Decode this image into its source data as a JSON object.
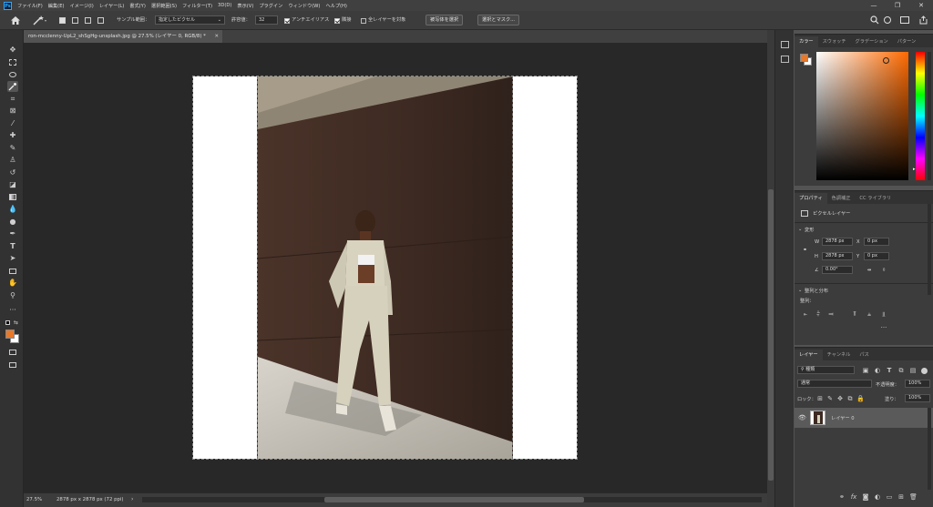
{
  "app": {
    "logo": "Ps"
  },
  "menu": [
    "ファイル(F)",
    "編集(E)",
    "イメージ(I)",
    "レイヤー(L)",
    "書式(Y)",
    "選択範囲(S)",
    "フィルター(T)",
    "3D(D)",
    "表示(V)",
    "プラグイン",
    "ウィンドウ(W)",
    "ヘルプ(H)"
  ],
  "window_controls": {
    "minimize": "—",
    "restore": "❐",
    "close": "✕"
  },
  "options": {
    "sample_label": "サンプル範囲：",
    "sample_value": "指定したピクセル",
    "tolerance_label": "許容値：",
    "tolerance_value": "32",
    "antialias_label": "アンチエイリアス",
    "contiguous_label": "隣接",
    "all_layers_label": "全レイヤーを対象",
    "select_subject_button": "被写体を選択",
    "select_mask_button": "選択とマスク..."
  },
  "document": {
    "tab_title": "ron-mcclenny-UpL2_shSgHg-unsplash.jpg @ 27.5% (レイヤー 0, RGB/8) *",
    "zoom": "27.5%",
    "size_info": "2878 px x 2878 px (72 ppi)"
  },
  "color_panel": {
    "tabs": [
      "カラー",
      "スウォッチ",
      "グラデーション",
      "パターン"
    ],
    "foreground": "#e8792a",
    "background": "#ffffff",
    "hue": "#ff6a00"
  },
  "properties_panel": {
    "tabs": [
      "プロパティ",
      "色調補正",
      "CC ライブラリ"
    ],
    "layer_type": "ピクセルレイヤー",
    "transform_title": "変形",
    "w_label": "W",
    "w_value": "2878 px",
    "h_label": "H",
    "h_value": "2878 px",
    "x_label": "X",
    "x_value": "0 px",
    "y_label": "Y",
    "y_value": "0 px",
    "angle_value": "0.00°",
    "align_title": "整列と分布",
    "align_label": "整列："
  },
  "layers_panel": {
    "tabs": [
      "レイヤー",
      "チャンネル",
      "パス"
    ],
    "filter_value": "種類",
    "blend_mode": "通常",
    "opacity_label": "不透明度：",
    "opacity_value": "100%",
    "lock_label": "ロック：",
    "fill_label": "塗り：",
    "fill_value": "100%",
    "layer_name": "レイヤー 0"
  },
  "colors": {
    "accent": "#e8792a",
    "selected_layer": "#5a5a5a"
  }
}
